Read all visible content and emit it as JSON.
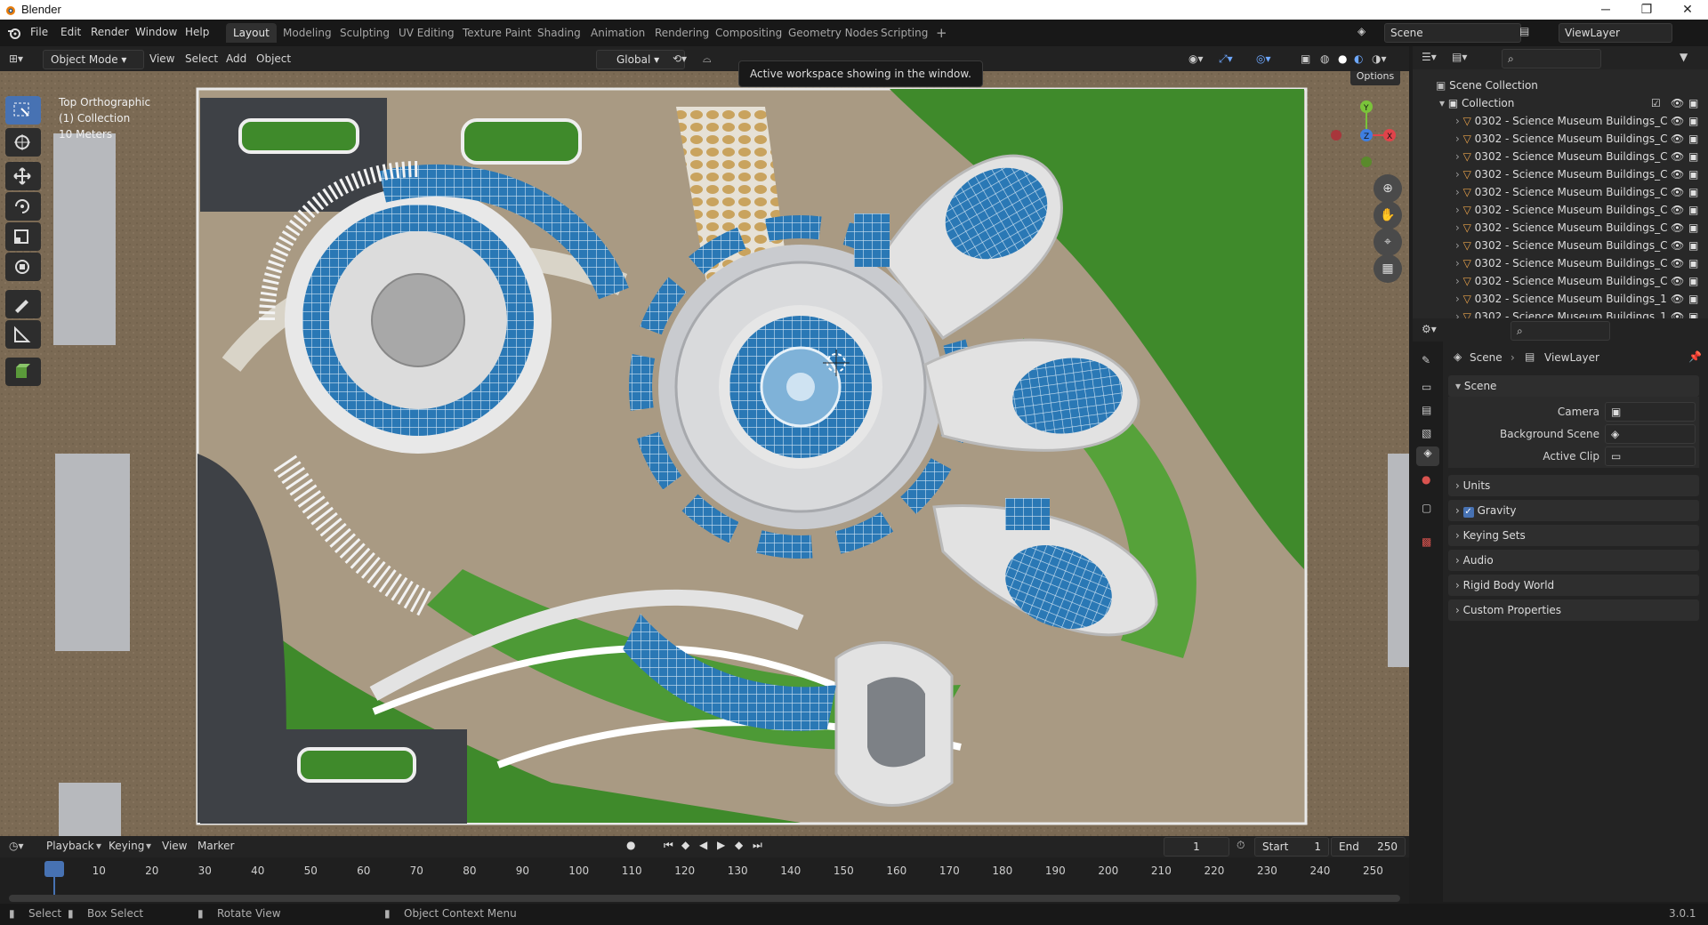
{
  "window": {
    "title": "Blender",
    "min": "─",
    "max": "❐",
    "close": "✕"
  },
  "menus": [
    "File",
    "Edit",
    "Render",
    "Window",
    "Help"
  ],
  "workspaces": [
    "Layout",
    "Modeling",
    "Sculpting",
    "UV Editing",
    "Texture Paint",
    "Shading",
    "Animation",
    "Rendering",
    "Compositing",
    "Geometry Nodes",
    "Scripting"
  ],
  "add_workspace": "+",
  "scene_field": "Scene",
  "viewlayer_field": "ViewLayer",
  "viewport_header": {
    "mode": "Object Mode",
    "menus": [
      "View",
      "Select",
      "Add",
      "Object"
    ],
    "orientation": "Global",
    "options": "Options"
  },
  "tooltip": "Active workspace showing in the window.",
  "overlay": {
    "view": "Top Orthographic",
    "collection": "(1) Collection",
    "scale": "10 Meters"
  },
  "outliner": {
    "root": "Scene Collection",
    "collection": "Collection",
    "objects": [
      "0302 - Science Museum Buildings_C",
      "0302 - Science Museum Buildings_C",
      "0302 - Science Museum Buildings_C",
      "0302 - Science Museum Buildings_C",
      "0302 - Science Museum Buildings_C",
      "0302 - Science Museum Buildings_C",
      "0302 - Science Museum Buildings_C",
      "0302 - Science Museum Buildings_C",
      "0302 - Science Museum Buildings_C",
      "0302 - Science Museum Buildings_C",
      "0302 - Science Museum Buildings_1",
      "0302 - Science Museum Buildings_1"
    ]
  },
  "properties": {
    "breadcrumb": [
      "Scene",
      "ViewLayer"
    ],
    "scene_panel": "Scene",
    "fields": [
      {
        "label": "Camera"
      },
      {
        "label": "Background Scene"
      },
      {
        "label": "Active Clip"
      }
    ],
    "panels": [
      "Units",
      "Gravity",
      "Keying Sets",
      "Audio",
      "Rigid Body World",
      "Custom Properties"
    ],
    "gravity_checked": true
  },
  "timeline": {
    "menus": [
      "Playback",
      "Keying",
      "View",
      "Marker"
    ],
    "current_frame": "1",
    "start_label": "Start",
    "start": "1",
    "end_label": "End",
    "end": "250",
    "ticks": [
      "1",
      "10",
      "20",
      "30",
      "40",
      "50",
      "60",
      "70",
      "80",
      "90",
      "100",
      "110",
      "120",
      "130",
      "140",
      "150",
      "160",
      "170",
      "180",
      "190",
      "200",
      "210",
      "220",
      "230",
      "240",
      "250"
    ]
  },
  "statusbar": {
    "items": [
      "Select",
      "Box Select",
      "Rotate View",
      "Object Context Menu"
    ],
    "version": "3.0.1"
  },
  "colors": {
    "accent": "#4772b3",
    "grass": "#3f8a2b",
    "water": "#2f6fa7"
  }
}
